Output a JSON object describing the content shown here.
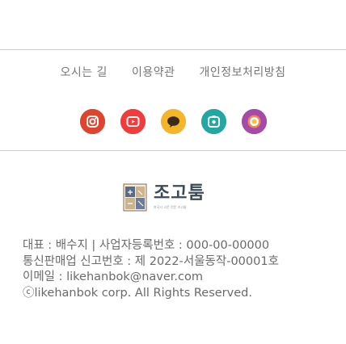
{
  "footer": {
    "links": [
      "오시는 길",
      "이용약관",
      "개인정보처리방침"
    ]
  },
  "sns": [
    {
      "icon": "instagram-icon",
      "color": "#e0442f"
    },
    {
      "icon": "youtube-icon",
      "color": "#f23b3b"
    },
    {
      "icon": "kakaotalk-icon",
      "color": "#f5b52a"
    },
    {
      "icon": "facebook-icon",
      "color": "#22a7a2"
    },
    {
      "icon": "blog-icon",
      "color": "#a54aa8"
    }
  ],
  "logo": {
    "title": "조고툼",
    "subtitle": "한국사 고문 전문 조고툼"
  },
  "company": {
    "ceo": "대표 : 배수지 | 사업자등록번호 : 000-00-00000",
    "registration": "통신판매업 신고번호 : 제 2022-서울동작-00001호",
    "email": "이메일 : likehanbok@naver.com",
    "copyright": "ⓒlikehanbok corp. All Rights Reserved."
  }
}
